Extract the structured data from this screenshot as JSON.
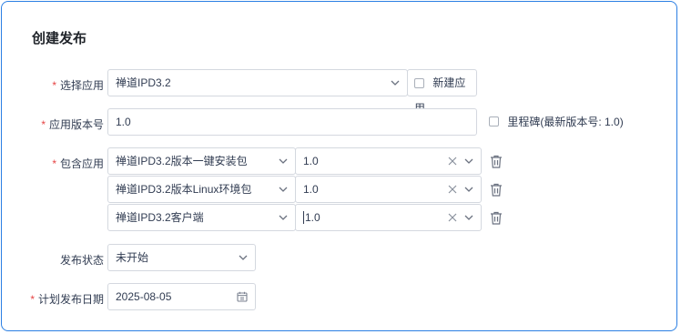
{
  "page_title": "创建发布",
  "form": {
    "app_label": "选择应用",
    "app_value": "禅道IPD3.2",
    "new_app_label": "新建应用",
    "version_label": "应用版本号",
    "version_value": "1.0",
    "milestone_label": "里程碑(最新版本号: 1.0)",
    "includes_label": "包含应用",
    "includes": [
      {
        "app": "禅道IPD3.2版本一键安装包",
        "version": "1.0"
      },
      {
        "app": "禅道IPD3.2版本Linux环境包",
        "version": "1.0"
      },
      {
        "app": "禅道IPD3.2客户端",
        "version": "1.0"
      }
    ],
    "status_label": "发布状态",
    "status_value": "未开始",
    "date_label": "计划发布日期",
    "date_value": "2025-08-05"
  },
  "icons": {
    "caret": "chevron-down-icon",
    "clear": "close-icon",
    "delete": "trash-icon",
    "date": "calendar-icon"
  },
  "colors": {
    "accent_border": "#2b7fe3",
    "required": "#e64545",
    "input_border": "#d4d8df"
  }
}
